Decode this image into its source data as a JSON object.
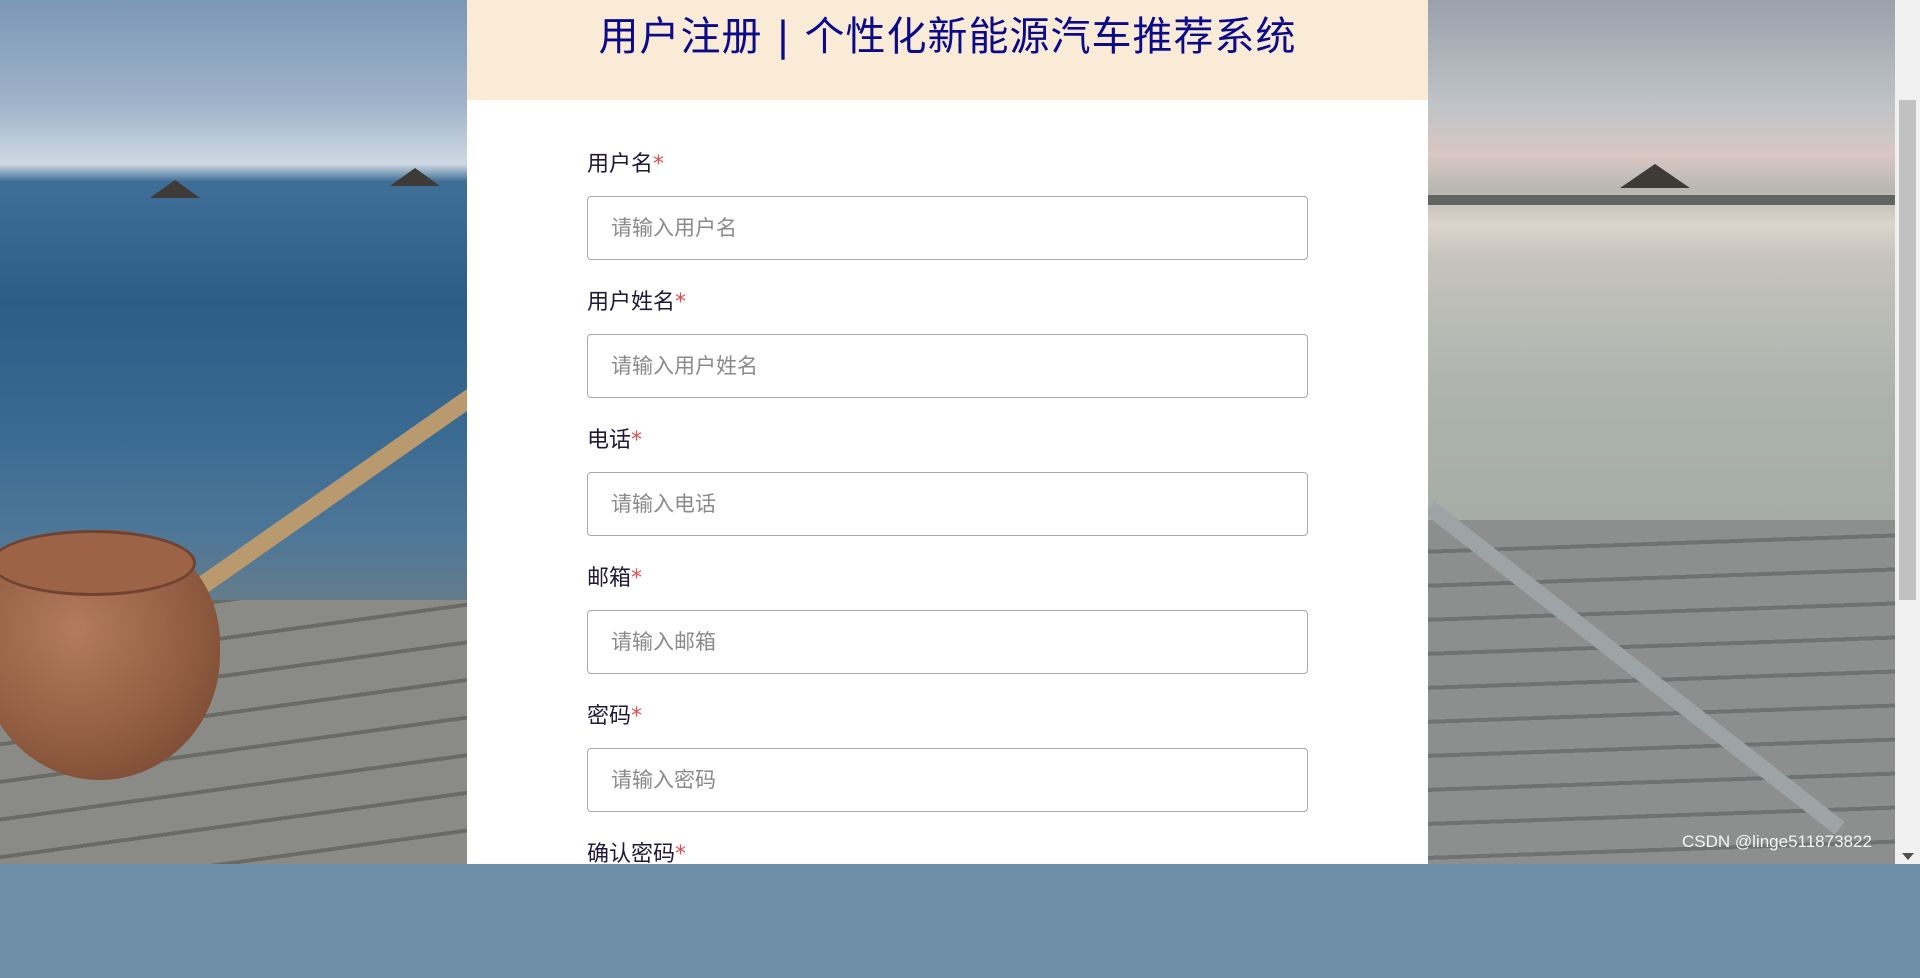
{
  "header": {
    "title": "用户注册 | 个性化新能源汽车推荐系统"
  },
  "form": {
    "required_mark": "*",
    "fields": [
      {
        "label": "用户名",
        "placeholder": "请输入用户名"
      },
      {
        "label": "用户姓名",
        "placeholder": "请输入用户姓名"
      },
      {
        "label": "电话",
        "placeholder": "请输入电话"
      },
      {
        "label": "邮箱",
        "placeholder": "请输入邮箱"
      },
      {
        "label": "密码",
        "placeholder": "请输入密码"
      },
      {
        "label": "确认密码"
      }
    ]
  },
  "watermark": "CSDN @linge511873822",
  "colors": {
    "header_bg": "#faebd7",
    "title": "#0b0b8a",
    "required": "#e84a4a"
  }
}
